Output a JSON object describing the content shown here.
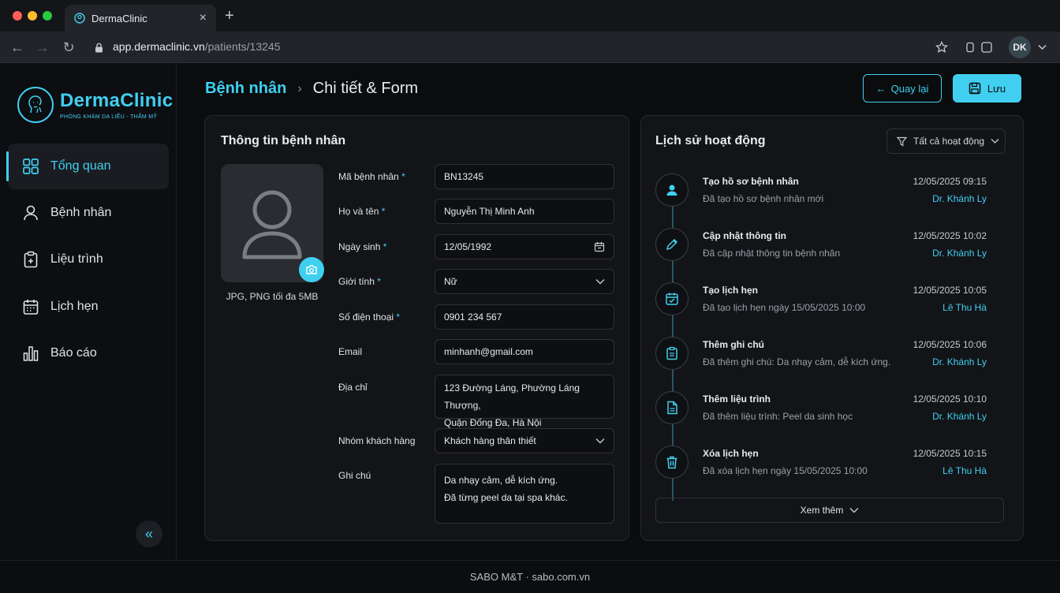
{
  "browser": {
    "tab_title": "DermaClinic",
    "url_host": "app.dermaclinic.vn",
    "url_path": "/patients/13245",
    "profile_initials": "DK",
    "traffic_colors": [
      "#ff5f57",
      "#febc2e",
      "#28c840"
    ]
  },
  "brand": {
    "name": "DermaClinic",
    "tagline": "PHÒNG KHÁM DA LIỄU - THẨM MỸ",
    "accent": "#40cff0"
  },
  "sidebar": {
    "items": [
      {
        "label": "Tổng quan",
        "icon": "grid-icon",
        "active": true
      },
      {
        "label": "Bệnh nhân",
        "icon": "user-icon",
        "active": false
      },
      {
        "label": "Liệu trình",
        "icon": "clipboard-icon",
        "active": false
      },
      {
        "label": "Lịch hẹn",
        "icon": "calendar-icon",
        "active": false
      },
      {
        "label": "Báo cáo",
        "icon": "bar-chart-icon",
        "active": false
      }
    ],
    "collapse_icon": "double-chevron-left-icon"
  },
  "header": {
    "breadcrumb_root": "Bệnh nhân",
    "breadcrumb_current": "Chi tiết & Form",
    "back_label": "Quay lại",
    "save_label": "Lưu"
  },
  "patient_card": {
    "title": "Thông tin bệnh nhân",
    "photo_hint": "JPG, PNG tối đa 5MB",
    "fields": {
      "id": {
        "label": "Mã bệnh nhân",
        "required": "*",
        "value": "BN13245"
      },
      "name": {
        "label": "Họ và tên",
        "required": "*",
        "value": "Nguyễn Thị Minh Anh"
      },
      "dob": {
        "label": "Ngày sinh",
        "required": "*",
        "value": "12/05/1992"
      },
      "gender": {
        "label": "Giới tính",
        "required": "*",
        "value": "Nữ"
      },
      "phone": {
        "label": "Số điện thoại",
        "required": "*",
        "value": "0901 234 567"
      },
      "email": {
        "label": "Email",
        "value": "minhanh@gmail.com"
      },
      "address": {
        "label": "Địa chỉ",
        "line1": "123 Đường Láng, Phường Láng Thượng,",
        "line2": "Quận Đống Đa, Hà Nội"
      },
      "group": {
        "label": "Nhóm khách hàng",
        "value": "Khách hàng thân thiết"
      },
      "note": {
        "label": "Ghi chú",
        "line1": "Da nhạy cảm, dễ kích ứng.",
        "line2": "Đã từng peel da tại spa khác."
      }
    }
  },
  "activity": {
    "title": "Lịch sử hoạt động",
    "filter_label": "Tất cả hoạt động",
    "more_label": "Xem thêm",
    "items": [
      {
        "icon": "user-icon",
        "title": "Tạo hồ sơ bệnh nhân",
        "desc": "Đã tạo hồ sơ bệnh nhân mới",
        "time": "12/05/2025 09:15",
        "user": "Dr. Khánh Ly"
      },
      {
        "icon": "pencil-icon",
        "title": "Cập nhật thông tin",
        "desc": "Đã cập nhật thông tin bệnh nhân",
        "time": "12/05/2025 10:02",
        "user": "Dr. Khánh Ly"
      },
      {
        "icon": "calendar-check-icon",
        "title": "Tạo lịch hẹn",
        "desc": "Đã tạo lịch hẹn ngày 15/05/2025 10:00",
        "time": "12/05/2025 10:05",
        "user": "Lê Thu Hà"
      },
      {
        "icon": "clipboard-icon",
        "title": "Thêm ghi chú",
        "desc": "Đã thêm ghi chú: Da nhạy cảm, dễ kích ứng.",
        "time": "12/05/2025 10:06",
        "user": "Dr. Khánh Ly"
      },
      {
        "icon": "document-icon",
        "title": "Thêm liệu trình",
        "desc": "Đã thêm liệu trình: Peel da sinh học",
        "time": "12/05/2025 10:10",
        "user": "Dr. Khánh Ly"
      },
      {
        "icon": "trash-icon",
        "title": "Xóa lịch hẹn",
        "desc": "Đã xóa lịch hẹn ngày 15/05/2025 10:00",
        "time": "12/05/2025 10:15",
        "user": "Lê Thu Hà"
      }
    ]
  },
  "footer": {
    "text": "SABO M&T · sabo.com.vn"
  }
}
